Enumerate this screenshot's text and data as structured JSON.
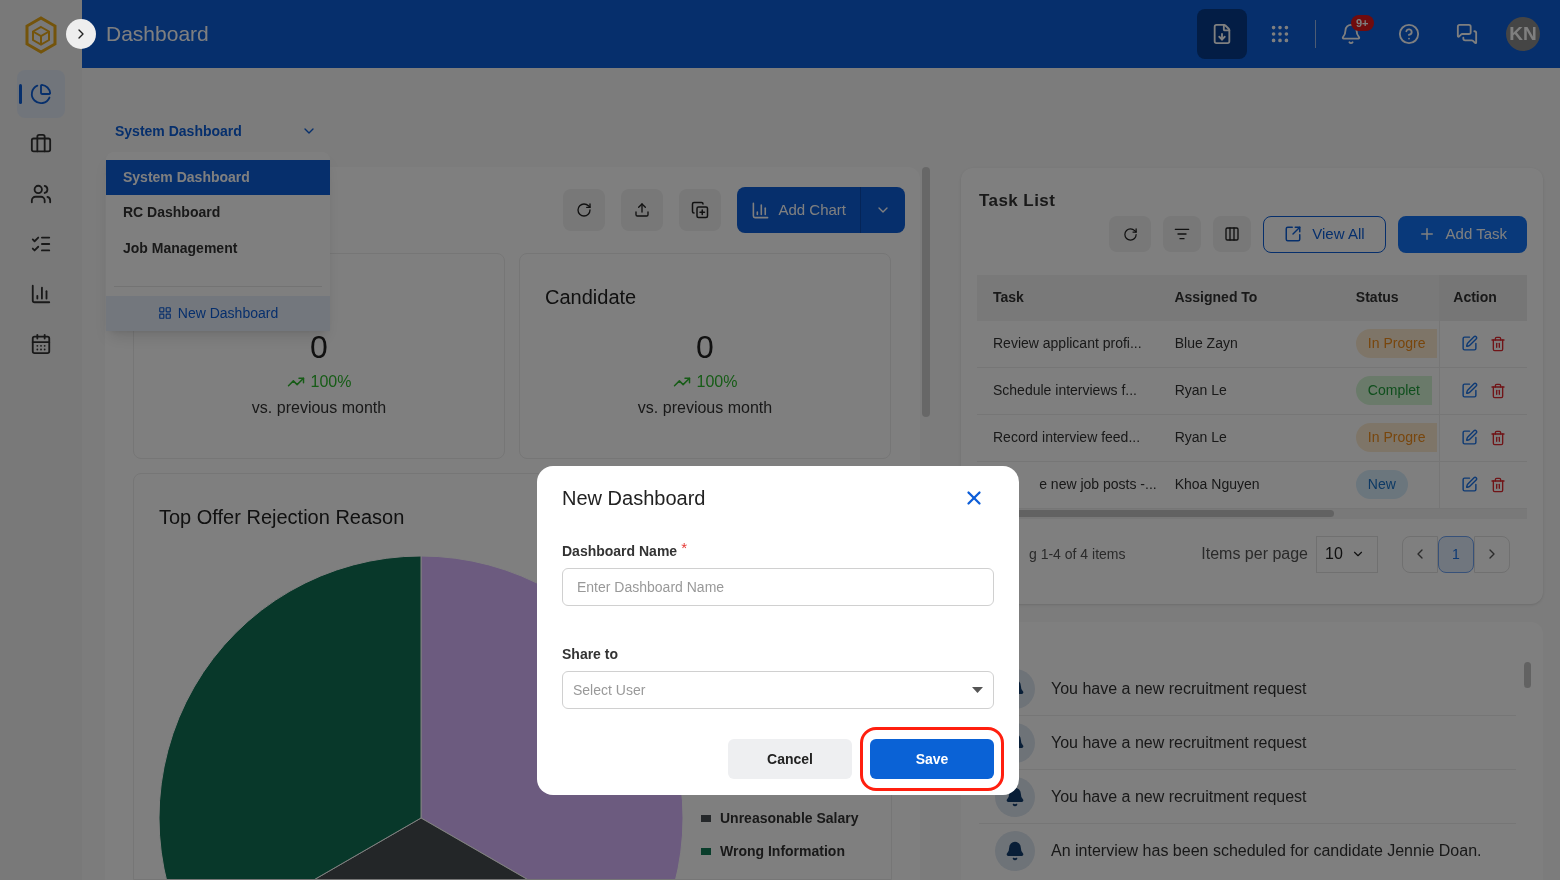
{
  "sidebar": {
    "items": [
      {
        "selected": true
      },
      {
        "selected": false
      },
      {
        "selected": false
      },
      {
        "selected": false
      },
      {
        "selected": false
      },
      {
        "selected": false
      }
    ]
  },
  "header": {
    "title": "Dashboard",
    "notification_badge": "9+",
    "avatar": "KN"
  },
  "dashboard_select": {
    "value": "System Dashboard",
    "expanded": true
  },
  "dashboard_menu": {
    "items": [
      {
        "label": "System Dashboard",
        "selected": true
      },
      {
        "label": "RC Dashboard",
        "selected": false
      },
      {
        "label": "Job Management",
        "selected": false
      }
    ],
    "new_button": "New Dashboard"
  },
  "toolbar": {
    "add_chart": "Add Chart"
  },
  "stat_cards": [
    {
      "value": "0",
      "change": "100%",
      "caption": "vs. previous month"
    },
    {
      "title": "Candidate",
      "value": "0",
      "change": "100%",
      "caption": "vs. previous month"
    }
  ],
  "chart_card": {
    "title": "Top Offer Rejection Reason",
    "legend": [
      {
        "label": "Unreasonable Salary",
        "color": "#25282a"
      },
      {
        "label": "Wrong Information",
        "color": "#093d2b"
      }
    ]
  },
  "task_list": {
    "title": "Task List",
    "view_all": "View All",
    "add_task": "Add Task",
    "columns": [
      "Task",
      "Assigned To",
      "Status",
      "Action"
    ],
    "rows": [
      {
        "task": "Review applicant profi...",
        "assigned_to": "Blue Zayn",
        "status": "In Progre",
        "kind": "in_progress",
        "cut_start": false
      },
      {
        "task": "Schedule interviews f...",
        "assigned_to": "Ryan Le",
        "status": "Complet",
        "kind": "completed",
        "cut_start": false
      },
      {
        "task": "Record interview feed...",
        "assigned_to": "Ryan Le",
        "status": "In Progre",
        "kind": "in_progress",
        "cut_start": false
      },
      {
        "task": "e new job posts -...",
        "assigned_to": "Khoa Nguyen",
        "status": "New",
        "kind": "new",
        "cut_start": true
      }
    ],
    "showing": "g 1-4 of 4 items",
    "items_per_page_label": "Items per page",
    "per_page": "10",
    "pages": [
      {
        "label": "1",
        "selected": true
      }
    ]
  },
  "notifications": [
    {
      "text": "You have a new recruitment request"
    },
    {
      "text": "You have a new recruitment request"
    },
    {
      "text": "You have a new recruitment request"
    },
    {
      "text": "An interview has been scheduled for candidate Jennie Doan."
    }
  ],
  "modal": {
    "title": "New Dashboard",
    "name_label": "Dashboard Name",
    "required_mark": "*",
    "name_placeholder": "Enter Dashboard Name",
    "share_label": "Share to",
    "share_placeholder": "Select User",
    "cancel": "Cancel",
    "save": "Save",
    "save_highlighted": true
  }
}
